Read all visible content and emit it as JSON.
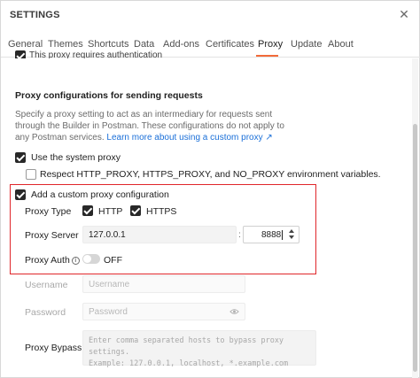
{
  "window": {
    "title": "SETTINGS",
    "close_icon": "close-icon"
  },
  "tabs": [
    {
      "label": "General",
      "active": false
    },
    {
      "label": "Themes",
      "active": false
    },
    {
      "label": "Shortcuts",
      "active": false
    },
    {
      "label": "Data",
      "active": false
    },
    {
      "label": "Add-ons",
      "active": false
    },
    {
      "label": "Certificates",
      "active": false
    },
    {
      "label": "Proxy",
      "active": true
    },
    {
      "label": "Update",
      "active": false
    },
    {
      "label": "About",
      "active": false
    }
  ],
  "accent_color": "#f26b3a",
  "highlight_color": "#e0262a",
  "link_color": "#1a6fd8",
  "proxy": {
    "cutoff_option": "This proxy requires authentication",
    "section_heading": "Proxy configurations for sending requests",
    "description": "Specify a proxy setting to act as an intermediary for requests sent through the Builder in Postman. These configurations do not apply to any Postman services.",
    "learn_more_link": "Learn more about using a custom proxy ↗",
    "use_system_proxy": {
      "label": "Use the system proxy",
      "checked": true
    },
    "respect_env": {
      "label": "Respect HTTP_PROXY, HTTPS_PROXY, and NO_PROXY environment variables.",
      "checked": false
    },
    "custom_proxy": {
      "label": "Add a custom proxy configuration",
      "checked": true,
      "proxy_type_label": "Proxy Type",
      "http_label": "HTTP",
      "http_checked": true,
      "https_label": "HTTPS",
      "https_checked": true,
      "server_label": "Proxy Server",
      "server_value": "127.0.0.1",
      "separator": ":",
      "port_value": "8888",
      "auth_label": "Proxy Auth",
      "auth_toggle": "OFF"
    },
    "username_label": "Username",
    "username_placeholder": "Username",
    "password_label": "Password",
    "password_placeholder": "Password",
    "bypass_label": "Proxy Bypass",
    "bypass_placeholder_line1": "Enter comma separated hosts to bypass proxy settings.",
    "bypass_placeholder_line2": "Example: 127.0.0.1, localhost, *.example.com"
  }
}
